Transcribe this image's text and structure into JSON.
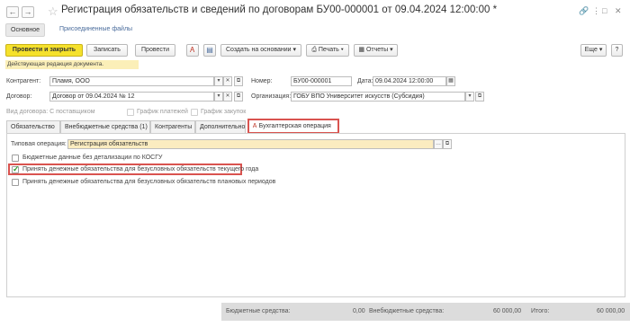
{
  "window": {
    "title": "Регистрация обязательств и сведений по договорам БУ00-000001 от 09.04.2024 12:00:00 *",
    "nav_back": "←",
    "nav_forward": "→",
    "star": "☆",
    "icons": [
      "link-icon",
      "more-icon",
      "maximize-icon",
      "close-icon"
    ]
  },
  "tabs": {
    "main": "Основное",
    "attached": "Присоединенные файлы"
  },
  "toolbar": {
    "post_close": "Провести и закрыть",
    "save": "Записать",
    "post": "Провести",
    "create_based": "Создать на основании",
    "print": "Печать",
    "reports": "Отчеты",
    "more": "Еще",
    "help": "?"
  },
  "notice": "Действующая редакция документа.",
  "form": {
    "counterparty_label": "Контрагент:",
    "counterparty_value": "Пламя, ООО",
    "number_label": "Номер:",
    "number_value": "БУ00-000001",
    "date_label": "Дата:",
    "date_value": "09.04.2024 12:00:00",
    "contract_label": "Договор:",
    "contract_value": "Договор от 09.04.2024 № 12",
    "org_label": "Организация:",
    "org_value": "ГОБУ ВПО Университет искусств (Субсидия)",
    "contract_type": "Вид договора: С поставщиком",
    "payments_schedule": "График платежей",
    "purchases_schedule": "График закупок"
  },
  "inner_tabs": [
    "Обязательство",
    "Внебюджетные средства (1)",
    "Контрагенты",
    "Дополнительно",
    "Бухгалтерская операция"
  ],
  "panel": {
    "operation_label": "Типовая операция:",
    "operation_value": "Регистрация обязательств",
    "checkbox1": "Бюджетные данные без детализации по КОСГУ",
    "checkbox2": "Принять денежные обязательства для безусловных обязательств текущего года",
    "checkbox2_checked": true,
    "checkbox3": "Принять денежные обязательства для безусловных обязательств плановых периодов"
  },
  "footer": {
    "budget_label": "Бюджетные средства:",
    "budget_value": "0,00",
    "extrabudget_label": "Внебюджетные средства:",
    "extrabudget_value": "60 000,00",
    "total_label": "Итого:",
    "total_value": "60 000,00"
  },
  "colors": {
    "primary_button": "#f5e12c",
    "highlight": "#d9534f",
    "notice": "#fbefb8",
    "field_yellow": "#fbecc0",
    "link": "#4a6c9c"
  }
}
